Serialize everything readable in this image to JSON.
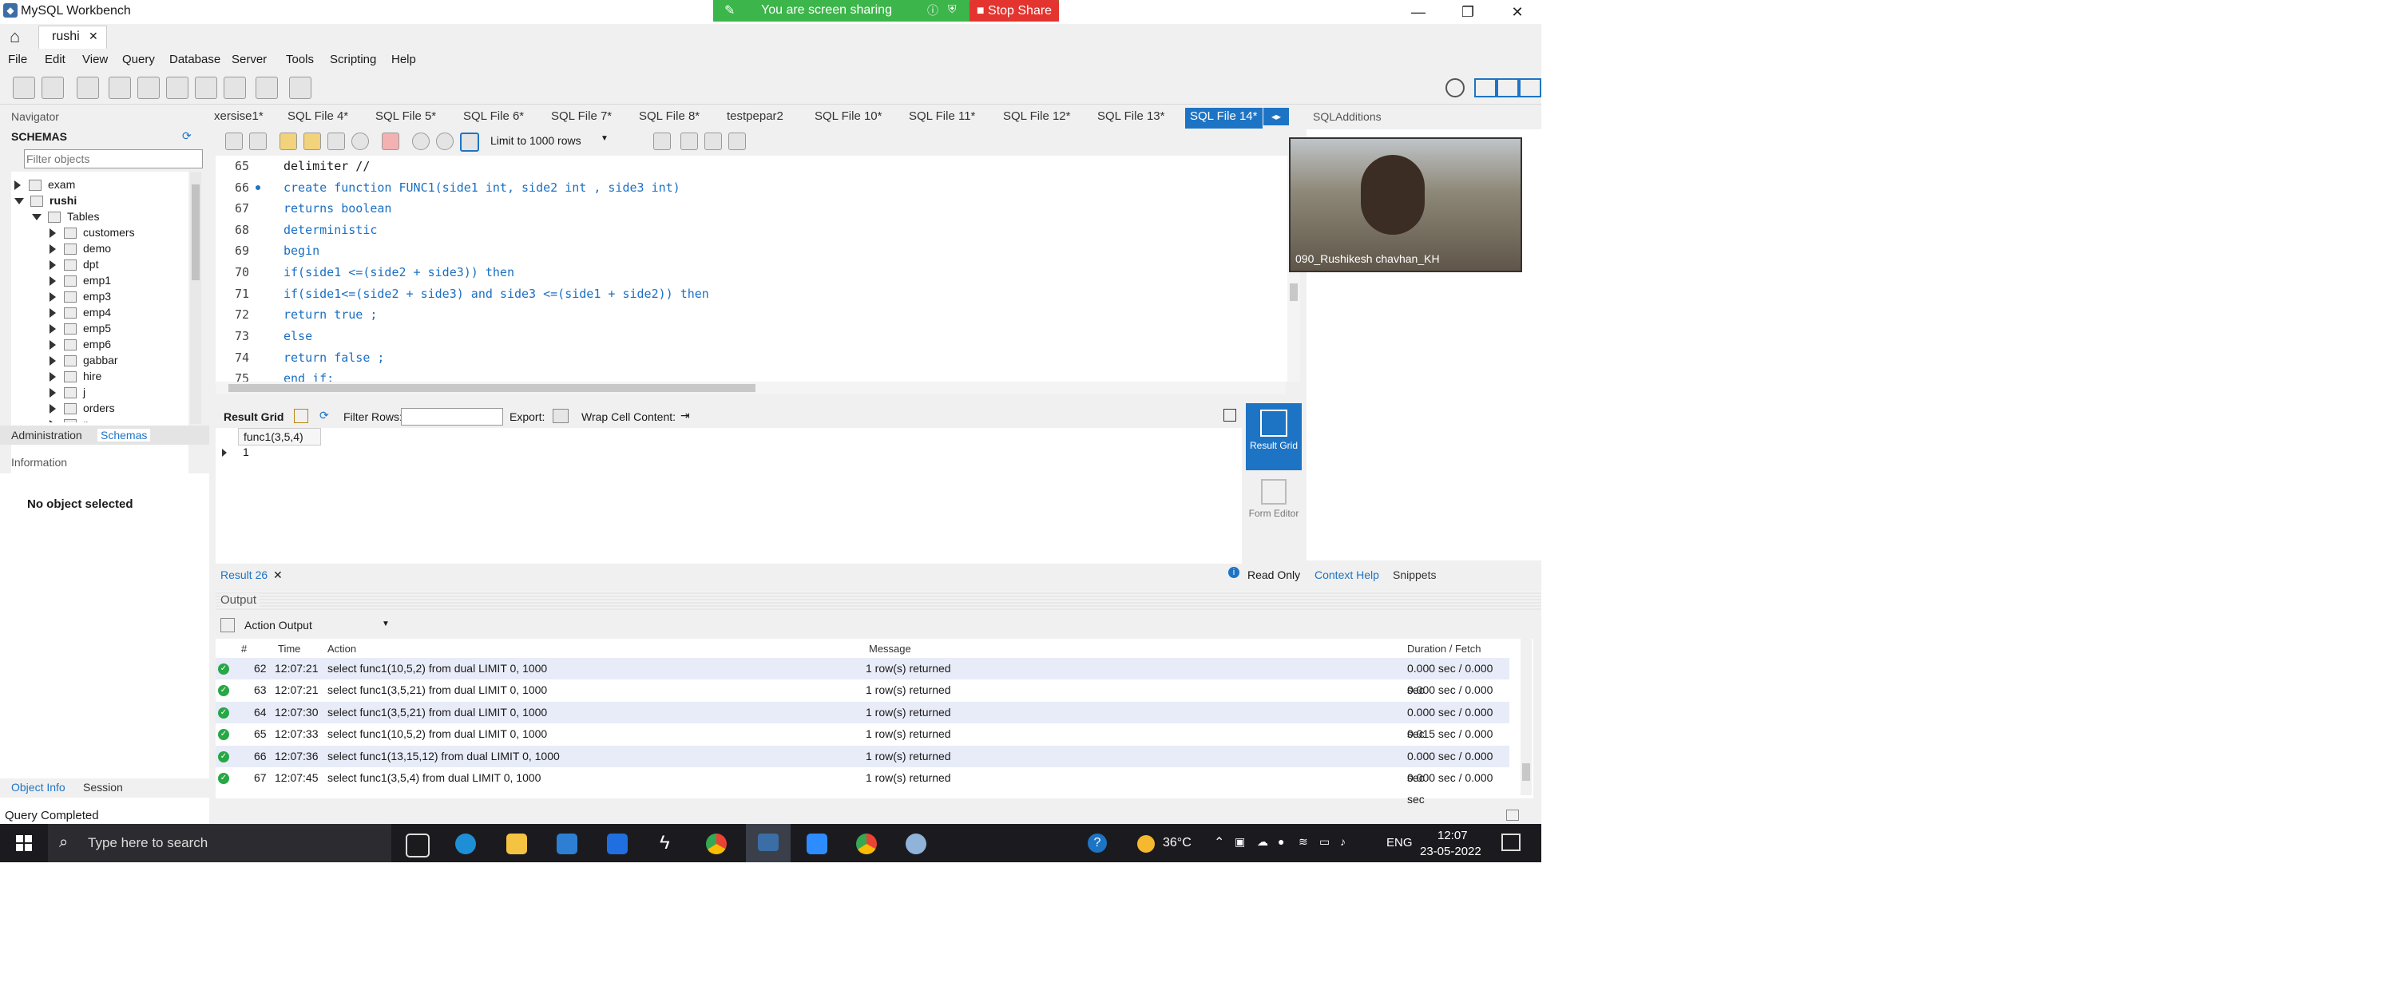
{
  "window": {
    "title": "MySQL Workbench",
    "connection_tab": "rushi",
    "minimize": "—",
    "maximize": "❐",
    "close": "✕"
  },
  "screen_share": {
    "status": "You are screen sharing",
    "stop_label": "Stop Share"
  },
  "menu": [
    "File",
    "Edit",
    "View",
    "Query",
    "Database",
    "Server",
    "Tools",
    "Scripting",
    "Help"
  ],
  "navigator": {
    "title": "Navigator",
    "schemas_header": "SCHEMAS",
    "filter_placeholder": "Filter objects",
    "schemas": [
      "exam",
      "rushi"
    ],
    "tables_label": "Tables",
    "tables": [
      "customers",
      "demo",
      "dpt",
      "emp1",
      "emp3",
      "emp4",
      "emp5",
      "emp6",
      "gabbar",
      "hire",
      "j",
      "orders",
      "p"
    ],
    "tabs": [
      "Administration",
      "Schemas"
    ],
    "information_title": "Information",
    "no_object": "No object selected",
    "bottom_tabs": [
      "Object Info",
      "Session"
    ]
  },
  "editor_tabs": [
    "xersise1*",
    "SQL File 4*",
    "SQL File 5*",
    "SQL File 6*",
    "SQL File 7*",
    "SQL File 8*",
    "testpepar2",
    "SQL File 10*",
    "SQL File 11*",
    "SQL File 12*",
    "SQL File 13*",
    "SQL File 14*"
  ],
  "active_tab": "SQL File 14*",
  "editor_toolbar": {
    "limit": "Limit to 1000 rows"
  },
  "code": [
    {
      "n": "65",
      "text": "delimiter //"
    },
    {
      "n": "66",
      "text": "create function FUNC1(side1 int, side2 int , side3 int)"
    },
    {
      "n": "67",
      "text": "returns boolean"
    },
    {
      "n": "68",
      "text": "deterministic"
    },
    {
      "n": "69",
      "text": "begin"
    },
    {
      "n": "70",
      "text": "if(side1 <=(side2 + side3)) then"
    },
    {
      "n": "71",
      "text": "if(side1<=(side2 + side3) and side3 <=(side1 + side2)) then"
    },
    {
      "n": "72",
      "text": "return true ;"
    },
    {
      "n": "73",
      "text": "else"
    },
    {
      "n": "74",
      "text": "return false ;"
    },
    {
      "n": "75",
      "text": "end if;"
    }
  ],
  "result_toolbar": {
    "result_grid": "Result Grid",
    "filter_rows": "Filter Rows:",
    "export": "Export:",
    "wrap": "Wrap Cell Content:"
  },
  "result_grid": {
    "column": "func1(3,5,4)",
    "value": "1"
  },
  "side_buttons": {
    "result_grid": "Result Grid",
    "form_editor": "Form Editor"
  },
  "result_tab": "Result 26",
  "read_only": "Read Only",
  "context_tabs": [
    "Context Help",
    "Snippets"
  ],
  "right_panel_title": "SQLAdditions",
  "webcam_name": "090_Rushikesh chavhan_KH",
  "output": {
    "title": "Output",
    "mode": "Action Output",
    "headers": [
      "#",
      "Time",
      "Action",
      "Message",
      "Duration / Fetch"
    ],
    "rows": [
      {
        "n": "62",
        "time": "12:07:21",
        "action": "select func1(10,5,2) from dual LIMIT 0, 1000",
        "msg": "1 row(s) returned",
        "dur": "0.000 sec / 0.000 sec"
      },
      {
        "n": "63",
        "time": "12:07:21",
        "action": "select func1(3,5,21) from dual LIMIT 0, 1000",
        "msg": "1 row(s) returned",
        "dur": "0.000 sec / 0.000 sec"
      },
      {
        "n": "64",
        "time": "12:07:30",
        "action": "select func1(3,5,21) from dual LIMIT 0, 1000",
        "msg": "1 row(s) returned",
        "dur": "0.000 sec / 0.000 sec"
      },
      {
        "n": "65",
        "time": "12:07:33",
        "action": "select func1(10,5,2) from dual LIMIT 0, 1000",
        "msg": "1 row(s) returned",
        "dur": "0.015 sec / 0.000 sec"
      },
      {
        "n": "66",
        "time": "12:07:36",
        "action": "select func1(13,15,12) from dual LIMIT 0, 1000",
        "msg": "1 row(s) returned",
        "dur": "0.000 sec / 0.000 sec"
      },
      {
        "n": "67",
        "time": "12:07:45",
        "action": "select func1(3,5,4) from dual LIMIT 0, 1000",
        "msg": "1 row(s) returned",
        "dur": "0.000 sec / 0.000 sec"
      }
    ]
  },
  "status": "Query Completed",
  "taskbar": {
    "search_placeholder": "Type here to search",
    "weather": "36°C",
    "lang": "ENG",
    "time": "12:07",
    "date": "23-05-2022"
  },
  "colors": {
    "accent": "#1e74c4",
    "keyword": "#1a6fc4",
    "share_green": "#3cb54a",
    "stop_red": "#e3342f"
  }
}
